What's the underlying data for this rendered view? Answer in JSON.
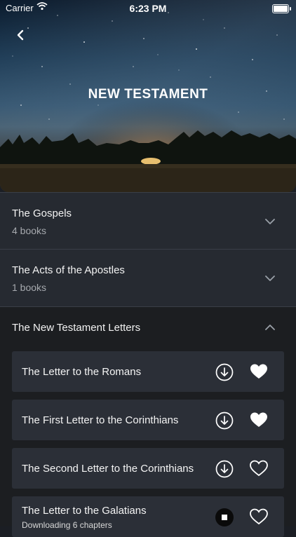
{
  "status_bar": {
    "carrier": "Carrier",
    "time": "6:23 PM"
  },
  "header": {
    "title": "NEW TESTAMENT"
  },
  "sections": [
    {
      "title": "The Gospels",
      "subtitle": "4 books",
      "expanded": false
    },
    {
      "title": "The Acts of the Apostles",
      "subtitle": "1 books",
      "expanded": false
    },
    {
      "title": "The New Testament Letters",
      "expanded": true
    }
  ],
  "books": [
    {
      "title": "The Letter to the Romans",
      "download": "available",
      "favorite": true
    },
    {
      "title": "The First Letter to the Corinthians",
      "download": "available",
      "favorite": true
    },
    {
      "title": "The Second Letter to the Corinthians",
      "download": "available",
      "favorite": false
    },
    {
      "title": "The Letter to the Galatians",
      "status": "Downloading 6 chapters",
      "download": "in-progress",
      "favorite": false
    }
  ],
  "icons": {
    "back": "chevron-left-icon",
    "expand": "chevron-down-icon",
    "collapse": "chevron-up-icon",
    "download": "download-circle-icon",
    "stop": "stop-download-icon",
    "favorite": "heart-icon"
  },
  "colors": {
    "background": "#1b1e24",
    "section": "#262a31",
    "card": "#2b2f37",
    "text": "#ffffff",
    "muted": "#a6a9ae"
  }
}
